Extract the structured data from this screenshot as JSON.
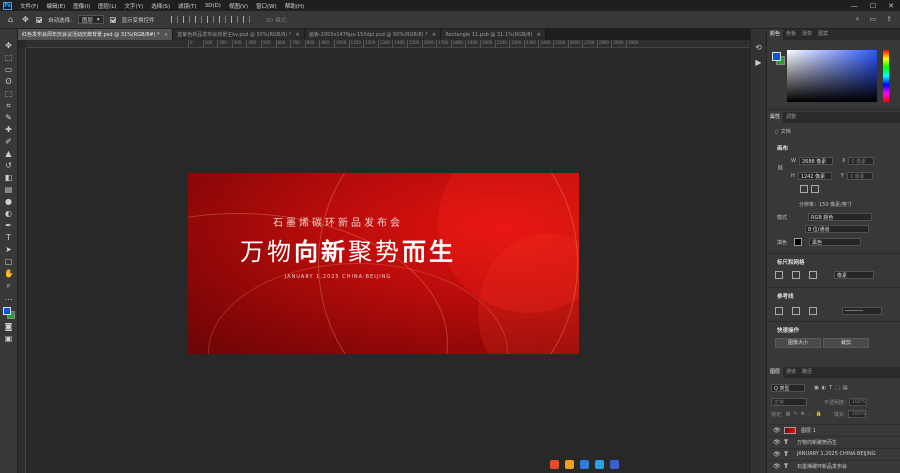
{
  "app": {
    "logo": "Ps"
  },
  "menu": [
    "文件(F)",
    "编辑(E)",
    "图像(I)",
    "图层(L)",
    "文字(Y)",
    "选择(S)",
    "滤镜(T)",
    "3D(D)",
    "视图(V)",
    "窗口(W)",
    "帮助(H)"
  ],
  "window_controls": [
    "—",
    "☐",
    "✕"
  ],
  "options": {
    "auto_select_label": "自动选择:",
    "auto_select_value": "图层",
    "show_transform_label": "显示变换控件",
    "mode_3d_label": "3D 模式:"
  },
  "tabs": [
    {
      "label": "红色发布会周年庆会议活动庆典背景.psd @ 31%(RGB/8#) *",
      "active": true
    },
    {
      "label": "蓝紫色新品发布会背景主kv.psd @ 50%(RGB/8) *",
      "active": false
    },
    {
      "label": "画板-2953x1476px-150dpi.psd @ 50%(RGB/8) *",
      "active": false
    },
    {
      "label": "Rectangle 11.psb @ 31.1%(RGB/8)",
      "active": false
    }
  ],
  "ruler_ticks": [
    "0",
    "100",
    "200",
    "300",
    "400",
    "500",
    "600",
    "700",
    "800",
    "900",
    "1000",
    "1100",
    "1200",
    "1300",
    "1400",
    "1500",
    "1600",
    "1700",
    "1800",
    "1900",
    "2000",
    "2100",
    "2200",
    "2300",
    "2400",
    "2500",
    "2600",
    "2700",
    "2800",
    "2900",
    "3000"
  ],
  "artboard": {
    "subtitle": "石墨烯碳环新品发布会",
    "title_light_1": "万物",
    "title_bold_1": "向新",
    "title_light_2": "聚势",
    "title_bold_2": "而生",
    "date": "JANUARY 1,2025   CHINA·BEIJING"
  },
  "colors": {
    "fg": "#0a56d8",
    "bg": "#2aa02a",
    "accent": "#c40d0c"
  },
  "color_panel": {
    "tabs": [
      "颜色",
      "色板",
      "渐变",
      "图案"
    ]
  },
  "properties": {
    "tabs": [
      "属性",
      "调整"
    ],
    "doc_label": "文档",
    "canvas_title": "画布",
    "w_label": "W",
    "w_value": "2688 像素",
    "x_label": "X",
    "x_value": "0 像素",
    "h_label": "H",
    "h_value": "1242 像素",
    "y_label": "Y",
    "y_value": "0 像素",
    "resolution": "分辨率：150 像素/英寸",
    "mode_label": "模式",
    "mode_value": "RGB 颜色",
    "depth_value": "8 位/通道",
    "fill_label": "填色",
    "fill_value": "黑色",
    "rulers_title": "标尺和网格",
    "rulers_unit": "像素",
    "guides_title": "参考线",
    "quick_title": "快速操作",
    "image_size_btn": "图像大小",
    "crop_btn": "裁剪"
  },
  "layers": {
    "tabs": [
      "图层",
      "通道",
      "路径"
    ],
    "filter_label": "Q 类型",
    "blend_mode": "正常",
    "opacity_label": "不透明度:",
    "opacity_value": "100%",
    "lock_label": "锁定:",
    "fill_label": "填充:",
    "fill_value": "100%",
    "items": [
      {
        "name": "图层 1",
        "kind": "image"
      },
      {
        "name": "万物向新聚势而生",
        "kind": "text"
      },
      {
        "name": "JANUARY 1,2025   CHINA·BEIJING",
        "kind": "text"
      },
      {
        "name": "石墨烯碳环新品发布会",
        "kind": "text"
      }
    ]
  }
}
